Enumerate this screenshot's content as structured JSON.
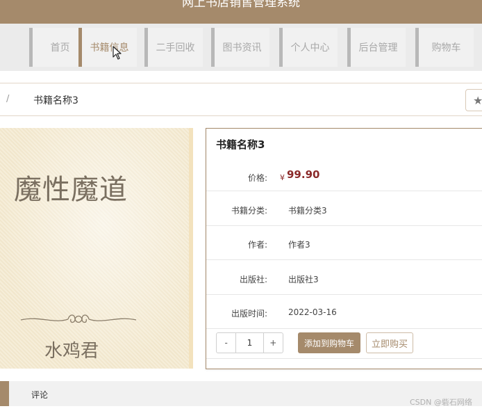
{
  "app": {
    "title": "网上书店销售管理系统"
  },
  "nav": {
    "items": [
      {
        "label": "首页",
        "active": false
      },
      {
        "label": "书籍信息",
        "active": true
      },
      {
        "label": "二手回收",
        "active": false
      },
      {
        "label": "图书资讯",
        "active": false
      },
      {
        "label": "个人中心",
        "active": false
      },
      {
        "label": "后台管理",
        "active": false
      },
      {
        "label": "购物车",
        "active": false
      }
    ]
  },
  "breadcrumb": {
    "separator": "/",
    "current": "书籍名称3"
  },
  "favorite": {
    "icon": "star-icon"
  },
  "cover": {
    "title": "魔性魔道",
    "author": "水鸡君"
  },
  "book": {
    "name": "书籍名称3",
    "price_label": "价格:",
    "currency": "¥",
    "price": "99.90",
    "fields": [
      {
        "label": "书籍分类:",
        "value": "书籍分类3"
      },
      {
        "label": "作者:",
        "value": "作者3"
      },
      {
        "label": "出版社:",
        "value": "出版社3"
      },
      {
        "label": "出版时间:",
        "value": "2022-03-16"
      }
    ]
  },
  "actions": {
    "decrement": "-",
    "quantity": "1",
    "increment": "+",
    "add_to_cart": "添加到购物车",
    "buy_now": "立即购买"
  },
  "tabs": {
    "comments": "评论"
  },
  "watermark": "CSDN @砦石网络",
  "colors": {
    "accent": "#a58a6b",
    "price": "#8b2a2a",
    "nav_bg": "#ebebeb"
  }
}
